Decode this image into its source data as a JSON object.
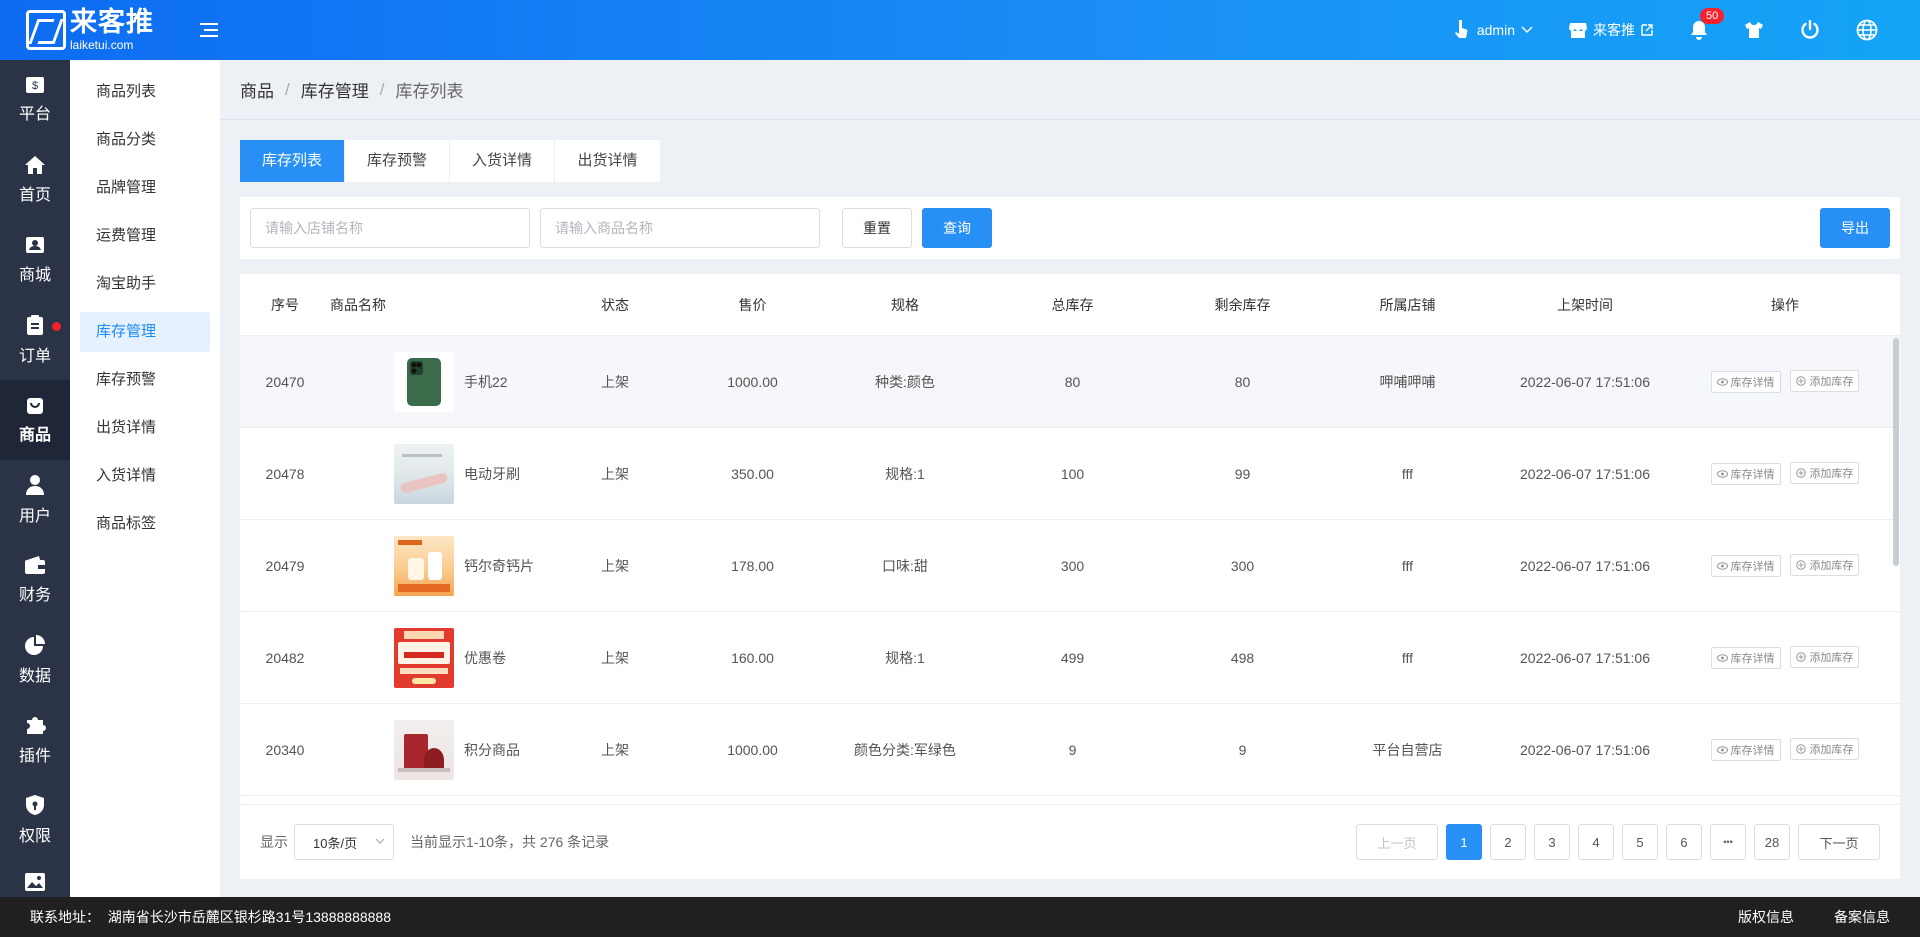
{
  "header": {
    "logo_cn": "来客推",
    "logo_en": "laiketui.com",
    "user": "admin",
    "shop": "来客推",
    "notif_count": "50",
    "icons": [
      "hand-pointer-icon",
      "store-icon",
      "bell-icon",
      "tshirt-icon",
      "power-icon",
      "globe-icon"
    ]
  },
  "sidebar": {
    "items": [
      {
        "label": "平台",
        "icon": "dollar-icon"
      },
      {
        "label": "首页",
        "icon": "home-icon"
      },
      {
        "label": "商城",
        "icon": "shop-icon"
      },
      {
        "label": "订单",
        "icon": "order-icon"
      },
      {
        "label": "商品",
        "icon": "bag-icon"
      },
      {
        "label": "用户",
        "icon": "user-icon"
      },
      {
        "label": "财务",
        "icon": "wallet-icon"
      },
      {
        "label": "数据",
        "icon": "pie-chart-icon"
      },
      {
        "label": "插件",
        "icon": "puzzle-icon"
      },
      {
        "label": "权限",
        "icon": "shield-icon"
      },
      {
        "label": "",
        "icon": "image-icon"
      }
    ]
  },
  "submenu": {
    "items": [
      "商品列表",
      "商品分类",
      "品牌管理",
      "运费管理",
      "淘宝助手",
      "库存管理",
      "库存预警",
      "出货详情",
      "入货详情",
      "商品标签"
    ]
  },
  "breadcrumb": {
    "a": "商品",
    "b": "库存管理",
    "c": "库存列表",
    "sep": "/"
  },
  "tabs": [
    "库存列表",
    "库存预警",
    "入货详情",
    "出货详情"
  ],
  "filter": {
    "shop_placeholder": "请输入店铺名称",
    "product_placeholder": "请输入商品名称",
    "reset": "重置",
    "query": "查询",
    "export": "导出"
  },
  "table": {
    "headers": [
      "序号",
      "商品名称",
      "状态",
      "售价",
      "规格",
      "总库存",
      "剩余库存",
      "所属店铺",
      "上架时间",
      "操作"
    ],
    "op_detail": "库存详情",
    "op_add": "添加库存",
    "rows": [
      {
        "id": "20470",
        "name": "手机22",
        "status": "上架",
        "price": "1000.00",
        "spec": "种类:颜色",
        "total": "80",
        "remain": "80",
        "shop": "呷哺呷哺",
        "time": "2022-06-07 17:51:06"
      },
      {
        "id": "20478",
        "name": "电动牙刷",
        "status": "上架",
        "price": "350.00",
        "spec": "规格:1",
        "total": "100",
        "remain": "99",
        "shop": "fff",
        "time": "2022-06-07 17:51:06"
      },
      {
        "id": "20479",
        "name": "钙尔奇钙片",
        "status": "上架",
        "price": "178.00",
        "spec": "口味:甜",
        "total": "300",
        "remain": "300",
        "shop": "fff",
        "time": "2022-06-07 17:51:06"
      },
      {
        "id": "20482",
        "name": "优惠卷",
        "status": "上架",
        "price": "160.00",
        "spec": "规格:1",
        "total": "499",
        "remain": "498",
        "shop": "fff",
        "time": "2022-06-07 17:51:06"
      },
      {
        "id": "20340",
        "name": "积分商品",
        "status": "上架",
        "price": "1000.00",
        "spec": "颜色分类:军绿色",
        "total": "9",
        "remain": "9",
        "shop": "平台自营店",
        "time": "2022-06-07 17:51:06"
      }
    ]
  },
  "pager": {
    "show_label": "显示",
    "page_size": "10条/页",
    "record_text": "当前显示1-10条，共 276 条记录",
    "prev": "上一页",
    "next": "下一页",
    "pages": [
      "1",
      "2",
      "3",
      "4",
      "5",
      "6",
      "•••",
      "28"
    ]
  },
  "footer": {
    "address": "联系地址：  湖南省长沙市岳麓区银杉路31号13888888888",
    "copyright": "版权信息",
    "icp": "备案信息"
  },
  "colors": {
    "primary": "#2890f5",
    "sidebar": "#2b3446",
    "badge": "#f5222d"
  }
}
